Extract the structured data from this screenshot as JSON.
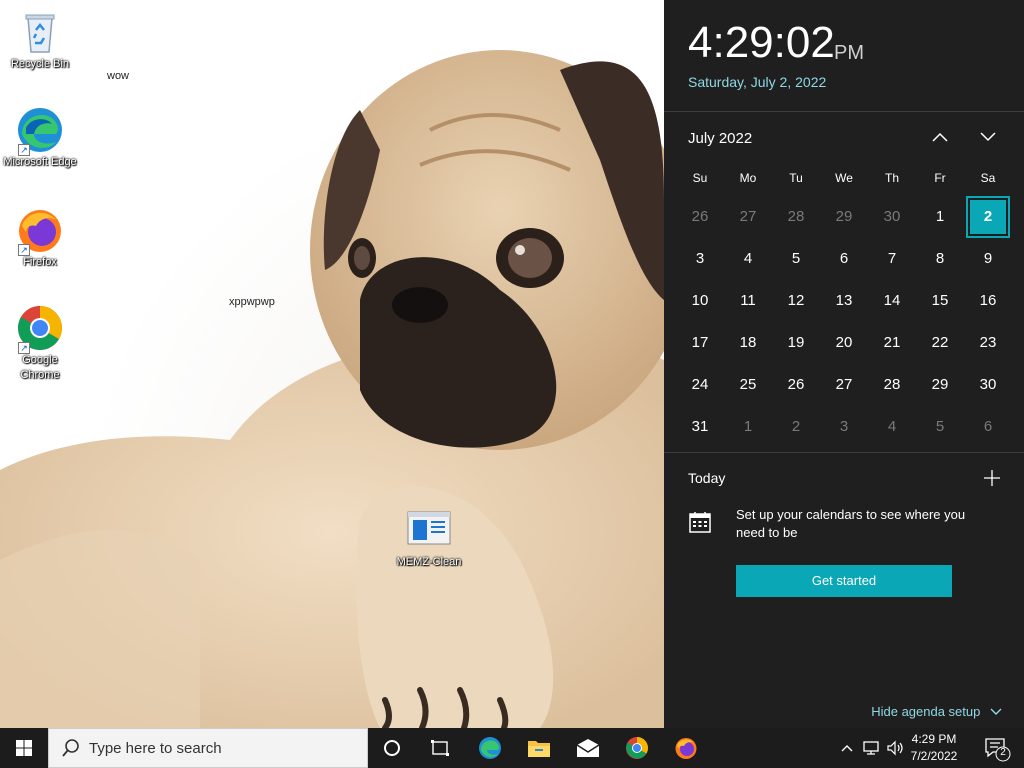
{
  "desktop": {
    "icons": [
      {
        "label": "Recycle Bin",
        "icon": "recycle-bin-icon"
      },
      {
        "label": "Microsoft Edge",
        "icon": "edge-icon"
      },
      {
        "label": "Firefox",
        "icon": "firefox-icon"
      },
      {
        "label": "Google Chrome",
        "icon": "chrome-icon"
      },
      {
        "label": "MEMZ-Clean",
        "icon": "window-app-icon"
      }
    ],
    "stray_text": [
      "wow",
      "xppwpwp"
    ]
  },
  "flyout": {
    "time": "4:29:02",
    "ampm": "PM",
    "date": "Saturday, July 2, 2022",
    "month_label": "July 2022",
    "weekdays": [
      "Su",
      "Mo",
      "Tu",
      "We",
      "Th",
      "Fr",
      "Sa"
    ],
    "weeks": [
      [
        "26",
        "27",
        "28",
        "29",
        "30",
        "1",
        "2"
      ],
      [
        "3",
        "4",
        "5",
        "6",
        "7",
        "8",
        "9"
      ],
      [
        "10",
        "11",
        "12",
        "13",
        "14",
        "15",
        "16"
      ],
      [
        "17",
        "18",
        "19",
        "20",
        "21",
        "22",
        "23"
      ],
      [
        "24",
        "25",
        "26",
        "27",
        "28",
        "29",
        "30"
      ],
      [
        "31",
        "1",
        "2",
        "3",
        "4",
        "5",
        "6"
      ]
    ],
    "selected_day": "2",
    "agenda": {
      "title": "Today",
      "message": "Set up your calendars to see where you need to be",
      "button": "Get started",
      "hide_link": "Hide agenda setup"
    },
    "accent_color": "#0aa7b7"
  },
  "taskbar": {
    "search_placeholder": "Type here to search",
    "clock_time": "4:29 PM",
    "clock_date": "7/2/2022",
    "notification_count": "2",
    "pinned": [
      "cortana-icon",
      "task-view-icon",
      "edge-icon",
      "file-explorer-icon",
      "mail-icon",
      "chrome-icon",
      "firefox-icon"
    ]
  }
}
